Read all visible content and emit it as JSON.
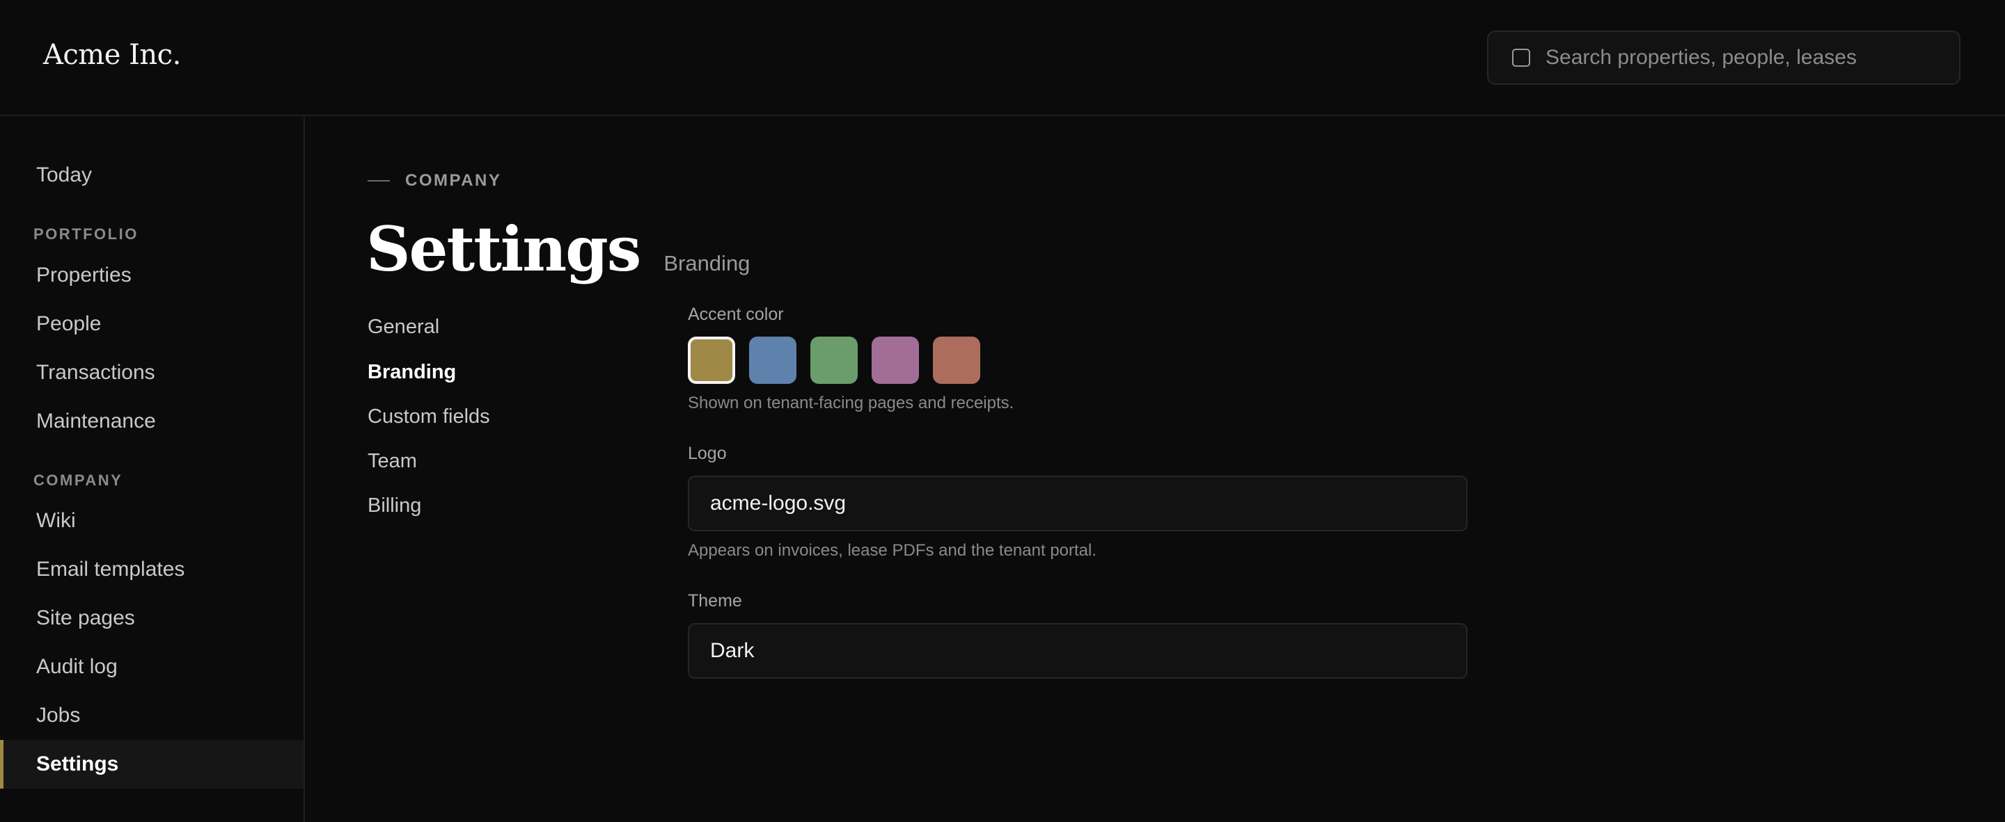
{
  "header": {
    "brand": "Acme Inc.",
    "search_placeholder": "Search properties, people, leases"
  },
  "sidebar": {
    "top_item": "Today",
    "sections": [
      {
        "title": "PORTFOLIO",
        "items": [
          "Properties",
          "People",
          "Transactions",
          "Maintenance"
        ]
      },
      {
        "title": "COMPANY",
        "items": [
          "Wiki",
          "Email templates",
          "Site pages",
          "Audit log",
          "Jobs",
          "Settings"
        ]
      }
    ],
    "active_item": "Settings"
  },
  "page": {
    "eyebrow": "COMPANY",
    "title": "Settings",
    "subtitle": "Branding"
  },
  "subnav": {
    "items": [
      "General",
      "Branding",
      "Custom fields",
      "Team",
      "Billing"
    ],
    "active": "Branding"
  },
  "form": {
    "accent": {
      "label": "Accent color",
      "colors": [
        "#a08947",
        "#5f82ad",
        "#6b9c6b",
        "#a26e98",
        "#ad6d5d"
      ],
      "selected_index": 0,
      "help": "Shown on tenant-facing pages and receipts."
    },
    "logo": {
      "label": "Logo",
      "value": "acme-logo.svg",
      "help": "Appears on invoices, lease PDFs and the tenant portal."
    },
    "theme": {
      "label": "Theme",
      "value": "Dark"
    }
  }
}
